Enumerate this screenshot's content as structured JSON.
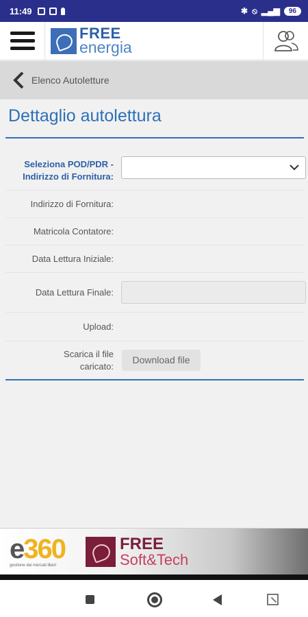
{
  "status_bar": {
    "time": "11:49",
    "battery": "96"
  },
  "header": {
    "logo_line1": "FREE",
    "logo_line2": "energia"
  },
  "breadcrumb": {
    "label": "Elenco Autoletture"
  },
  "page": {
    "title": "Dettaglio autolettura"
  },
  "form": {
    "pod_label_1": "Seleziona POD/PDR -",
    "pod_label_2": "Indirizzo di Fornitura:",
    "pod_value": "",
    "indirizzo_label": "Indirizzo di Fornitura:",
    "matricola_label": "Matricola Contatore:",
    "data_iniziale_label": "Data Lettura Iniziale:",
    "data_finale_label": "Data Lettura Finale:",
    "data_finale_value": "",
    "upload_label": "Upload:",
    "scarica_label_1": "Scarica il file",
    "scarica_label_2": "caricato:",
    "download_button": "Download file"
  },
  "banner": {
    "e360_e": "e",
    "e360_n": "360",
    "e360_tagline": "gestione dei mercati liberi",
    "fst_line1": "FREE",
    "fst_line2": "Soft&Tech"
  },
  "colors": {
    "status_bar": "#2b2f8c",
    "accent_blue": "#2d70b8",
    "brand_maroon": "#7a1e3a"
  },
  "icons": {
    "menu": "hamburger-icon",
    "user": "users-icon",
    "back": "chevron-left-icon",
    "select": "chevron-down-icon"
  }
}
